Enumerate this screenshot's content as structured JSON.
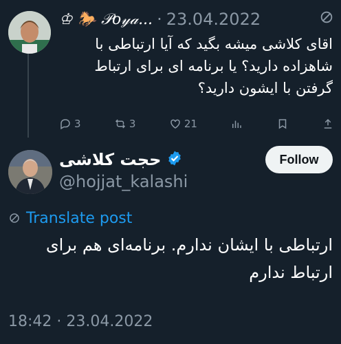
{
  "reply": {
    "author": "♔ 🐎 𝒫𝑜𝓎𝒶...",
    "separator": "·",
    "date": "23.04.2022",
    "text": "اقای کلاشی میشه بگید که آیا ارتباطی با شاهزاده دارید؟ یا برنامه ای برای ارتباط گرفتن با ایشون دارید؟",
    "icon": "ban-icon",
    "actions": {
      "replies": "3",
      "reposts": "3",
      "likes": "21",
      "views": "",
      "bookmark": "",
      "share": ""
    }
  },
  "main": {
    "name": "حجت کلاشی",
    "handle": "@hojjat_kalashi",
    "follow_label": "Follow",
    "translate_label": "Translate post",
    "text": "ارتباطی با ایشان ندارم. برنامه‌ای هم برای ارتباط ندارم",
    "timestamp": "18:42 · 23.04.2022"
  },
  "colors": {
    "background": "#15202b",
    "text_primary": "#ffffff",
    "text_secondary": "#8b98a5",
    "accent": "#1d9bf0",
    "button_bg": "#eff3f4"
  }
}
